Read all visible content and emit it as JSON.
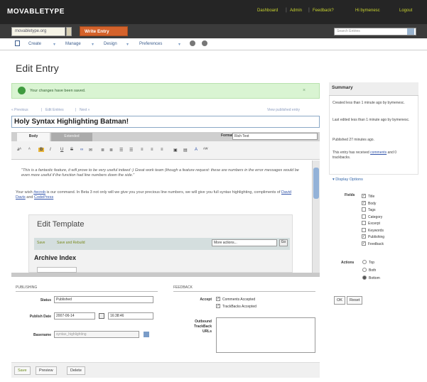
{
  "app": {
    "logo": "MOVABLETYPE"
  },
  "header": {
    "links": [
      "Dashboard",
      "Admin",
      "Feedback?",
      "Hi bymenesc",
      "Logout"
    ]
  },
  "blog": {
    "selector": "movabletype.org",
    "write_button": "Write Entry",
    "search_placeholder": "Search Entries"
  },
  "menu": {
    "items": [
      "Create",
      "Manage",
      "Design",
      "Preferences"
    ]
  },
  "page": {
    "title": "Edit Entry"
  },
  "message": {
    "text": "Your changes have been saved."
  },
  "nav": {
    "prev": "« Previous",
    "sep1": "|",
    "manage": "Edit Entries",
    "sep2": "|",
    "next": "Next »",
    "view_link": "View published entry"
  },
  "entry": {
    "title": "Holy Syntax Highlighting Batman!",
    "tab_body": "Body",
    "tab_extended": "Extended",
    "format_label": "Format",
    "format_value": "Rich Text",
    "para1": "\"This is a fantastic feature, it will prove to be very useful indeed :) Great work team (though a feature request: these are numbers in the error messages would be even more useful if the function had line numbers down the side.\"",
    "para2_a": "Your wish",
    "para2_b": "#ecrob",
    "para2_c": "is our command. In Beta 3 not only will we give you your precious line numbers, we will give you full syntax highlighting, compliments of",
    "para2_d": "David Davis",
    "para2_e": "and",
    "para2_f": "CodePress"
  },
  "shot": {
    "title": "Edit Template",
    "save": "Save",
    "save_rebuild": "Save and Rebuild",
    "more": "More actions...",
    "go": "Go",
    "archive": "Archive Index"
  },
  "publishing": {
    "heading": "PUBLISHING",
    "status_label": "Status",
    "status_value": "Published",
    "date_label": "Publish Date",
    "date_value": "2007-06-14",
    "time_value": "16:38:46",
    "basename_label": "Basename",
    "basename_value": "syntax_highlighting"
  },
  "feedback": {
    "heading": "FEEDBACK",
    "accept_label": "Accept",
    "comments": "Comments Accepted",
    "trackbacks": "TrackBacks Accepted",
    "tb_label_1": "Outbound",
    "tb_label_2": "TrackBack",
    "tb_label_3": "URLs"
  },
  "buttons": {
    "save": "Save",
    "preview": "Preview",
    "delete": "Delete"
  },
  "summary": {
    "heading": "Summary",
    "line1": "Created less than 1 minute ago by bymenesc.",
    "line2": "Last edited less than 1 minute ago by bymenesc.",
    "line3": "Published 27 minutes ago.",
    "line4a": "This entry has received",
    "line4b": "comments",
    "line4c": "and 0 trackbacks."
  },
  "display": {
    "heading": "Display Options",
    "fields_label": "Fields",
    "fields": [
      {
        "label": "Title",
        "checked": true
      },
      {
        "label": "Body",
        "checked": true
      },
      {
        "label": "Tags",
        "checked": false
      },
      {
        "label": "Category",
        "checked": false
      },
      {
        "label": "Excerpt",
        "checked": false
      },
      {
        "label": "Keywords",
        "checked": false
      },
      {
        "label": "Publishing",
        "checked": true
      },
      {
        "label": "Feedback",
        "checked": true
      }
    ],
    "actions_label": "Actions",
    "actions": [
      {
        "label": "Top",
        "selected": false
      },
      {
        "label": "Both",
        "selected": false
      },
      {
        "label": "Bottom",
        "selected": true
      }
    ],
    "ok": "OK",
    "reset": "Reset"
  },
  "colors": {
    "topbar": "#252525",
    "accent": "#d4622b",
    "link": "#3b5c8c",
    "success_bg": "#d9f4d2"
  }
}
